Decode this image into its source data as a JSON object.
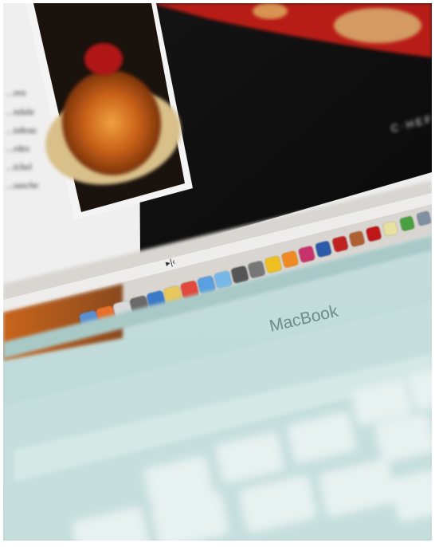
{
  "photo": {
    "brand_label": "MacBook",
    "overlay_text": "C·HEFS",
    "recipe_lines": [
      "...ren",
      "...ndale",
      "...ndeau",
      "...rdes",
      "...tchel",
      "...sasche"
    ],
    "dock_icons": [
      {
        "name": "finder-icon",
        "color": "#5b8fd0"
      },
      {
        "name": "firefox-icon",
        "color": "#e8702a"
      },
      {
        "name": "preview-icon",
        "color": "#d9d9d9"
      },
      {
        "name": "system-preferences-icon",
        "color": "#6b6b6b"
      },
      {
        "name": "itunes-icon",
        "color": "#3a7ac8"
      },
      {
        "name": "notes-folder-icon",
        "color": "#e8c85a"
      },
      {
        "name": "calendar-icon",
        "color": "#e04a3a"
      },
      {
        "name": "app-store-icon",
        "color": "#5aa0e0"
      },
      {
        "name": "mail-icon",
        "color": "#78b8e8"
      },
      {
        "name": "photo-booth-icon",
        "color": "#555555"
      },
      {
        "name": "camera-icon",
        "color": "#777777"
      },
      {
        "name": "adium-duck-icon",
        "color": "#f0c020"
      },
      {
        "name": "illustrator-icon",
        "color": "#f08a20"
      },
      {
        "name": "indesign-icon",
        "color": "#c8306a"
      },
      {
        "name": "photoshop-icon",
        "color": "#2a5aa8"
      },
      {
        "name": "acrobat-icon",
        "color": "#c02020"
      },
      {
        "name": "bridge-icon",
        "color": "#b06030"
      },
      {
        "name": "flash-icon",
        "color": "#c01818"
      },
      {
        "name": "stickies-icon",
        "color": "#e8e0a0"
      },
      {
        "name": "evernote-icon",
        "color": "#48a040"
      },
      {
        "name": "trash-icon",
        "color": "#8090a0"
      }
    ]
  }
}
